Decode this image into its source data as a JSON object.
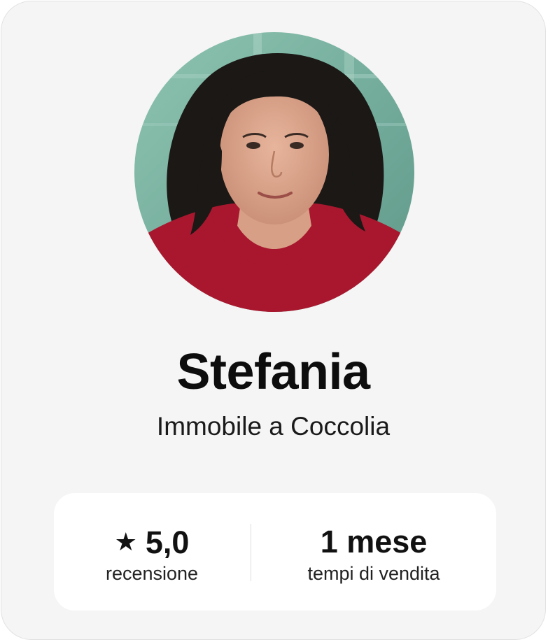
{
  "profile": {
    "name": "Stefania",
    "subtitle": "Immobile a Coccolia",
    "avatar_alt": "Stefania"
  },
  "stats": {
    "rating": {
      "icon": "star-icon",
      "value": "5,0",
      "label": "recensione"
    },
    "time": {
      "value": "1 mese",
      "label": "tempi di vendita"
    }
  },
  "colors": {
    "card_background": "#f5f5f5",
    "stats_background": "#ffffff",
    "text": "#111111",
    "avatar_shirt": "#a8172e",
    "avatar_background": "#7fb5a4"
  }
}
